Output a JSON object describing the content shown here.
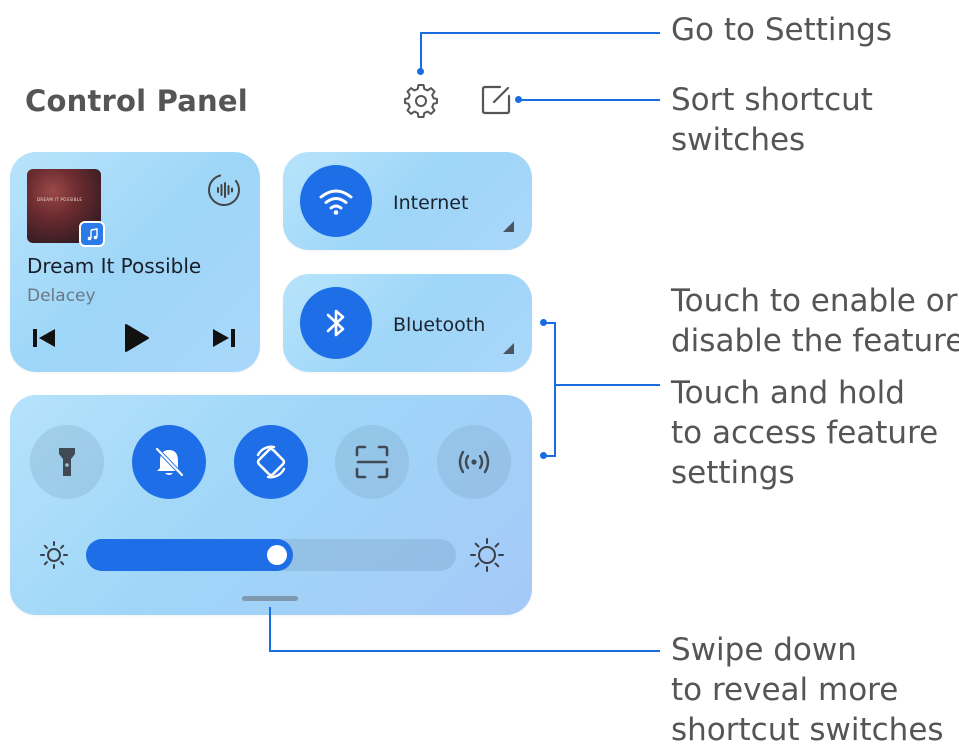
{
  "panel": {
    "title": "Control Panel"
  },
  "media": {
    "song_title": "Dream It Possible",
    "artist": "Delacey",
    "album_text": "DREAM IT POSSIBLE"
  },
  "toggles": {
    "internet_label": "Internet",
    "bluetooth_label": "Bluetooth"
  },
  "shortcuts": [
    {
      "name": "flashlight",
      "state": "off"
    },
    {
      "name": "silent",
      "state": "on"
    },
    {
      "name": "auto-rotate",
      "state": "on"
    },
    {
      "name": "screenshot",
      "state": "off"
    },
    {
      "name": "hotspot",
      "state": "off"
    }
  ],
  "brightness": {
    "level": 0.56
  },
  "callouts": {
    "settings": "Go to Settings",
    "sort_line1": "Sort shortcut",
    "sort_line2": "switches",
    "touch_line1": "Touch to enable or",
    "touch_line2": "disable the feature",
    "hold_line1": "Touch and hold",
    "hold_line2": "to access feature",
    "hold_line3": "settings",
    "swipe_line1": "Swipe down",
    "swipe_line2": "to reveal more",
    "swipe_line3": "shortcut switches"
  },
  "colors": {
    "accent": "#1e6ee8",
    "leader": "#1a6de0",
    "tile": "#a9dcf9"
  }
}
